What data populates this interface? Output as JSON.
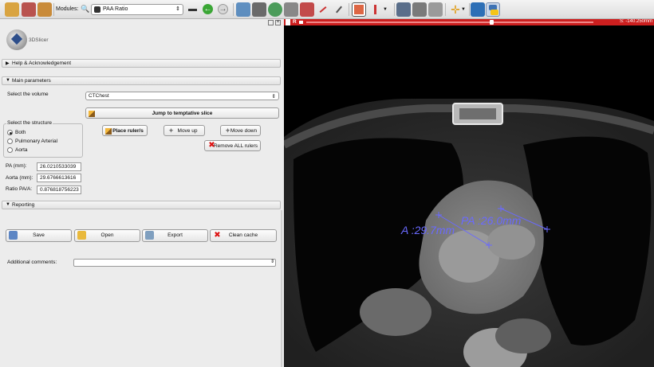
{
  "toolbar": {
    "modules_label": "Modules:",
    "module_selected": "PAA Ratio"
  },
  "logo": {
    "text": "3DSlicer"
  },
  "sections": {
    "help": "Help & Acknowledgement",
    "main": "Main parameters",
    "reporting": "Reporting"
  },
  "main": {
    "select_volume_label": "Select the volume",
    "volume_value": "CTChest",
    "jump_button": "Jump to temptative slice",
    "structure_group_label": "Select the structure",
    "structure_options": [
      "Both",
      "Pulmonary Arterial",
      "Aorta"
    ],
    "selected_structure": "Both",
    "place_ruler": "Place ruler/s",
    "move_up": "Move up",
    "move_down": "Move down",
    "remove_rulers": "Remove ALL rulers",
    "pa_label": "PA (mm):",
    "pa_value": "26.0210533039",
    "aorta_label": "Aorta (mm):",
    "aorta_value": "29.6766613616",
    "ratio_label": "Ratio PA/A:",
    "ratio_value": "0.876818756223"
  },
  "reporting": {
    "save": "Save",
    "open": "Open",
    "export": "Export",
    "clean_cache": "Clean cache",
    "comments_label": "Additional comments:",
    "comments_value": ""
  },
  "viewer": {
    "slice_letter": "R",
    "slice_position": "S: -140.250mm",
    "ruler_pa_label": "PA :26.0mm",
    "ruler_aorta_label": "A :29.7mm",
    "accent_color": "#cc1f1f",
    "ruler_color": "#6a6aff"
  }
}
